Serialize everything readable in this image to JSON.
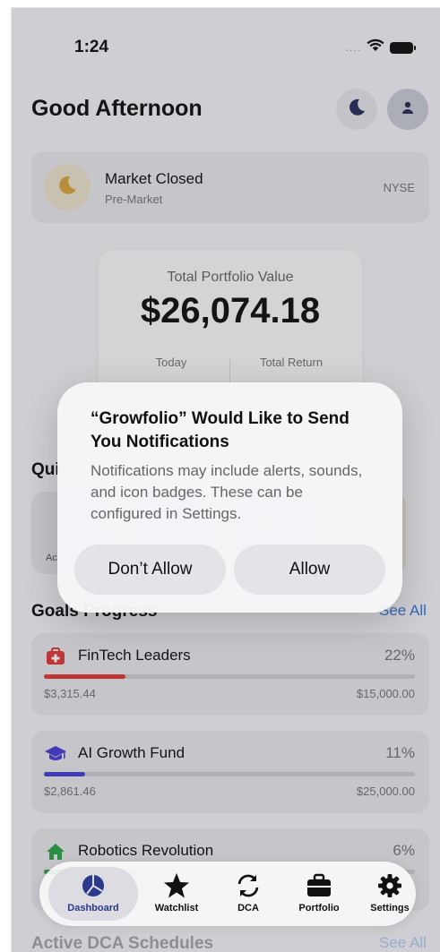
{
  "status_bar": {
    "time": "1:24",
    "signal_dots": "....",
    "icons": [
      "wifi-icon",
      "battery-icon"
    ]
  },
  "header": {
    "greeting": "Good Afternoon",
    "buttons": [
      "moon-icon",
      "user-icon"
    ]
  },
  "market_status": {
    "title": "Market Closed",
    "subtitle": "Pre-Market",
    "exchange": "NYSE",
    "icon": "moon-icon"
  },
  "portfolio": {
    "label": "Total Portfolio Value",
    "value": "$26,074.18",
    "today_label": "Today",
    "total_return_label": "Total Return"
  },
  "quick_actions": {
    "title": "Qui",
    "first_label": "Ac"
  },
  "goals": {
    "title": "Goals Progress",
    "see_all": "See All",
    "items": [
      {
        "name": "FinTech Leaders",
        "pct_text": "22%",
        "progress": 0.22,
        "current": "$3,315.44",
        "target": "$15,000.00",
        "color": "#e03a3a",
        "icon": "medical-kit-icon"
      },
      {
        "name": "AI Growth Fund",
        "pct_text": "11%",
        "progress": 0.11,
        "current": "$2,861.46",
        "target": "$25,000.00",
        "color": "#4b3fd6",
        "icon": "graduation-cap-icon"
      },
      {
        "name": "Robotics Revolution",
        "pct_text": "6%",
        "progress": 0.06,
        "color": "#2fa64b",
        "icon": "house-icon"
      }
    ]
  },
  "dca": {
    "title": "Active DCA Schedules",
    "see_all": "See All"
  },
  "tabbar": {
    "tabs": [
      {
        "label": "Dashboard",
        "icon": "pie-chart-icon",
        "active": true
      },
      {
        "label": "Watchlist",
        "icon": "star-icon",
        "active": false
      },
      {
        "label": "DCA",
        "icon": "cycle-arrows-icon",
        "active": false
      },
      {
        "label": "Portfolio",
        "icon": "briefcase-icon",
        "active": false
      },
      {
        "label": "Settings",
        "icon": "gear-icon",
        "active": false
      }
    ]
  },
  "alert": {
    "title": "“Growfolio” Would Like to Send You Notifications",
    "message": "Notifications may include alerts, sounds, and icon badges. These can be configured in Settings.",
    "deny_label": "Don’t Allow",
    "allow_label": "Allow"
  },
  "colors": {
    "accent": "#3b74d8",
    "positive": "#2b9a55",
    "active_tab": "#2b3a8a"
  }
}
